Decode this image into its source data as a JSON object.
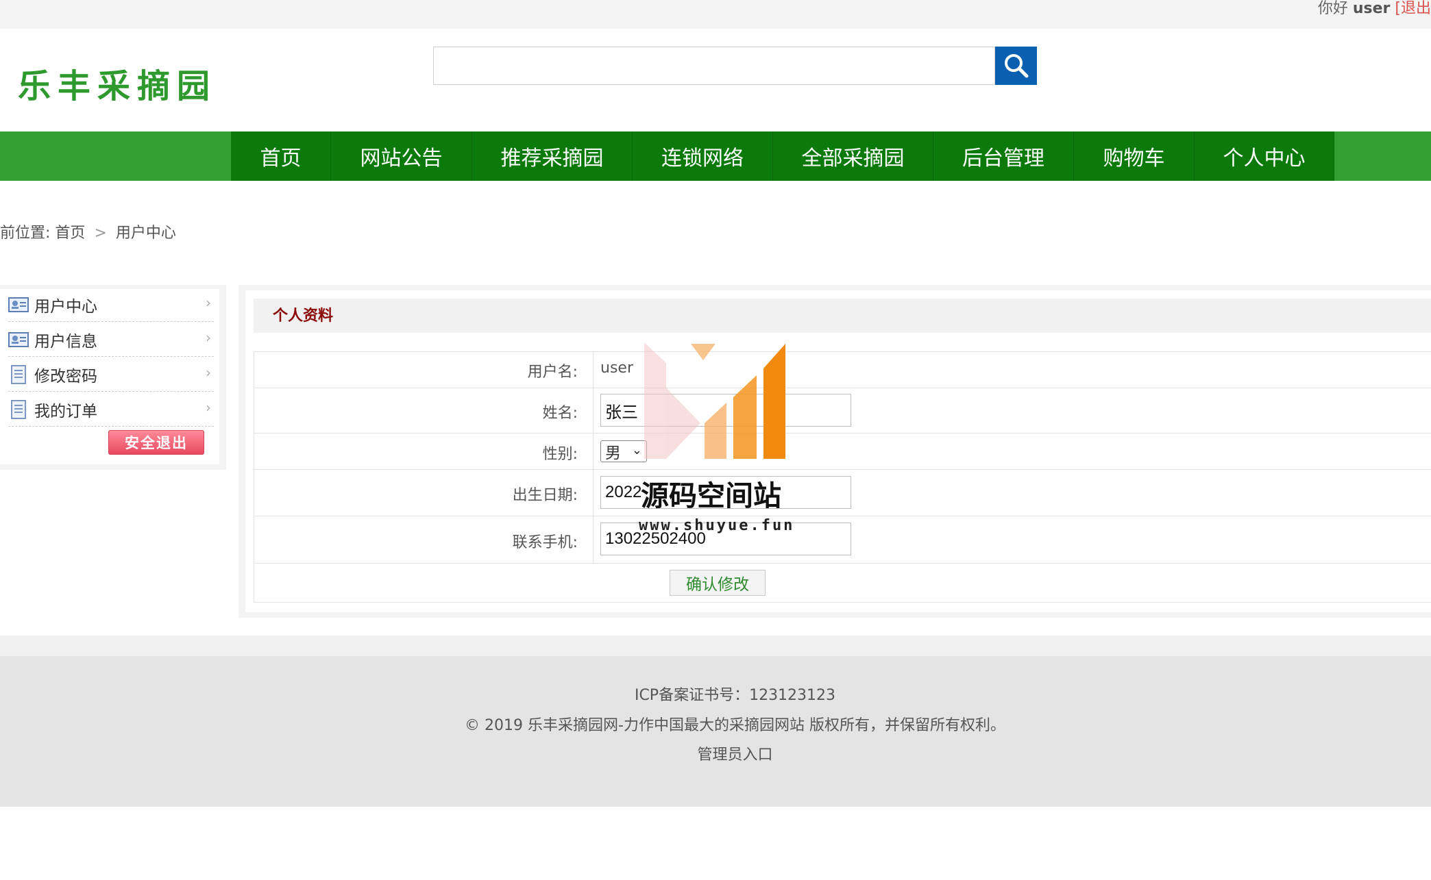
{
  "topbar": {
    "greeting": "你好",
    "username": "user",
    "logout": "[退出"
  },
  "header": {
    "logo": "乐丰采摘园",
    "search_placeholder": ""
  },
  "nav": {
    "items": [
      "首页",
      "网站公告",
      "推荐采摘园",
      "连锁网络",
      "全部采摘园",
      "后台管理",
      "购物车",
      "个人中心"
    ]
  },
  "breadcrumb": {
    "prefix": "当前位置:",
    "home": "首页",
    "separator": ">",
    "current": "用户中心"
  },
  "sidebar": {
    "items": [
      {
        "label": "用户中心",
        "icon": "id-card-icon"
      },
      {
        "label": "用户信息",
        "icon": "id-card-icon"
      },
      {
        "label": "修改密码",
        "icon": "document-icon"
      },
      {
        "label": "我的订单",
        "icon": "document-icon"
      }
    ],
    "exit_label": "安全退出"
  },
  "profile": {
    "title": "个人资料",
    "labels": {
      "username": "用户名:",
      "name": "姓名:",
      "gender": "性别:",
      "birth": "出生日期:",
      "phone": "联系手机:"
    },
    "values": {
      "username": "user",
      "name": "张三",
      "gender": "男",
      "birth": "2022",
      "phone": "13022502400"
    },
    "submit": "确认修改"
  },
  "watermark": {
    "title": "源码空间站",
    "url": "www.shuyue.fun"
  },
  "footer": {
    "icp": "ICP备案证书号：123123123",
    "copyright": "© 2019 乐丰采摘园网-力作中国最大的采摘园网站 版权所有，并保留所有权利。",
    "admin": "管理员入口"
  },
  "colors": {
    "nav_bg": "#0b7a0b",
    "nav_strip": "#33a033",
    "logo": "#2e9a2e",
    "search_button": "#0a5fb0",
    "panel_title": "#8b0a0a",
    "exit_button": "#e84a60"
  }
}
